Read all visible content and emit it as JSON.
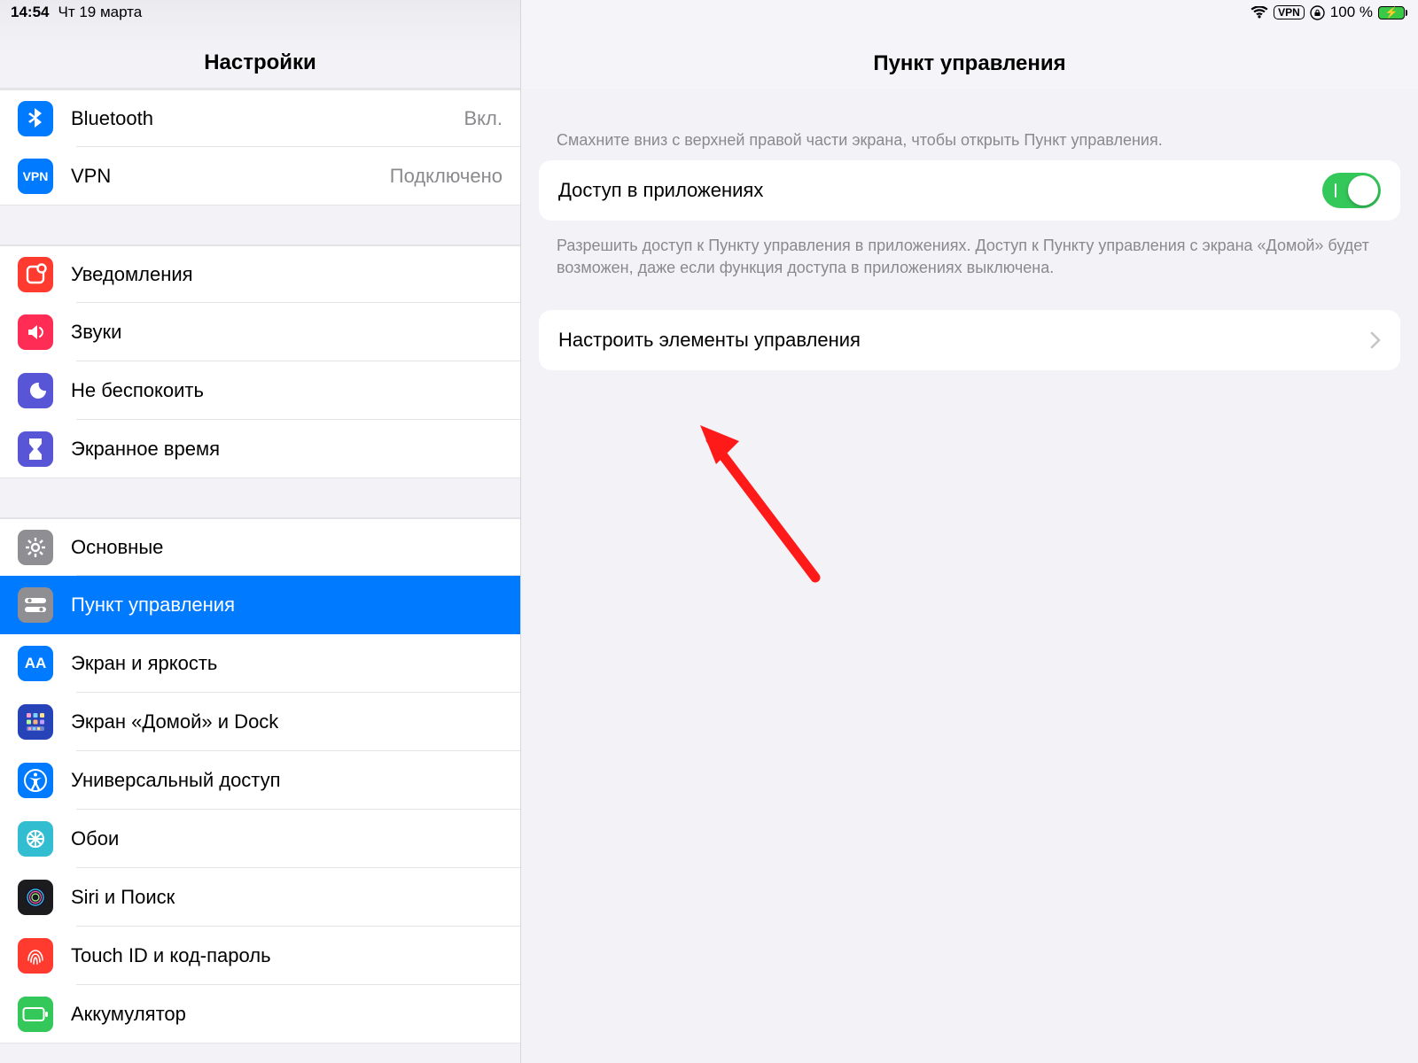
{
  "status": {
    "time": "14:54",
    "date": "Чт 19 марта",
    "vpn_badge": "VPN",
    "battery_pct": "100 %"
  },
  "sidebar": {
    "title": "Настройки",
    "group1": [
      {
        "label": "Bluetooth",
        "value": "Вкл.",
        "icon": "bluetooth"
      },
      {
        "label": "VPN",
        "value": "Подключено",
        "icon": "vpn"
      }
    ],
    "group2": [
      {
        "label": "Уведомления",
        "icon": "notifications"
      },
      {
        "label": "Звуки",
        "icon": "sounds"
      },
      {
        "label": "Не беспокоить",
        "icon": "dnd"
      },
      {
        "label": "Экранное время",
        "icon": "screentime"
      }
    ],
    "group3": [
      {
        "label": "Основные",
        "icon": "general"
      },
      {
        "label": "Пункт управления",
        "icon": "controlcenter",
        "selected": true
      },
      {
        "label": "Экран и яркость",
        "icon": "display"
      },
      {
        "label": "Экран «Домой» и Dock",
        "icon": "homescreen"
      },
      {
        "label": "Универсальный доступ",
        "icon": "accessibility"
      },
      {
        "label": "Обои",
        "icon": "wallpaper"
      },
      {
        "label": "Siri и Поиск",
        "icon": "siri"
      },
      {
        "label": "Touch ID и код-пароль",
        "icon": "touchid"
      },
      {
        "label": "Аккумулятор",
        "icon": "battery"
      }
    ]
  },
  "detail": {
    "title": "Пункт управления",
    "hint_top": "Смахните вниз с верхней правой части экрана, чтобы открыть Пункт управления.",
    "toggle_label": "Доступ в приложениях",
    "toggle_on": true,
    "hint_below": "Разрешить доступ к Пункту управления в приложениях. Доступ к Пункту управления с экрана «Домой» будет возможен, даже если функция доступа в приложениях выключена.",
    "customize_label": "Настроить элементы управления"
  }
}
